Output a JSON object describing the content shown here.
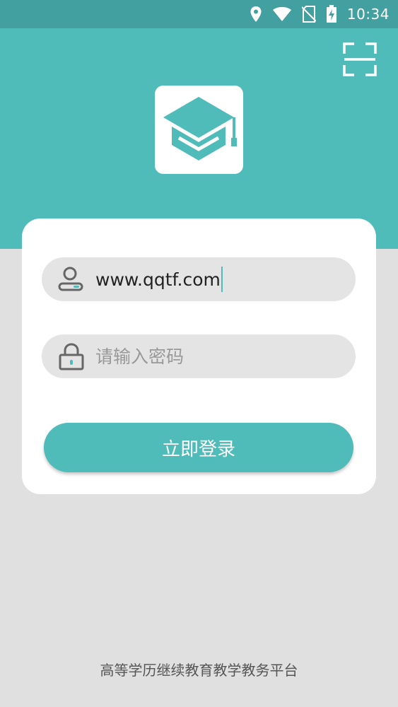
{
  "status_bar": {
    "time": "10:34",
    "icons": [
      "location-icon",
      "wifi-icon",
      "no-sim-icon",
      "battery-charging-icon"
    ]
  },
  "header": {
    "scan_icon": "scan-icon",
    "logo_icon": "graduation-cap-icon"
  },
  "login_form": {
    "username": {
      "icon": "user-icon",
      "value": "www.qqtf.com"
    },
    "password": {
      "icon": "lock-icon",
      "placeholder": "请输入密码"
    },
    "submit_label": "立即登录"
  },
  "footer": {
    "text": "高等学历继续教育教学教务平台"
  },
  "colors": {
    "accent": "#4fbcba",
    "status_bar": "#42a0a0",
    "background": "#e0e0e0",
    "field_bg": "#e4e4e4"
  }
}
